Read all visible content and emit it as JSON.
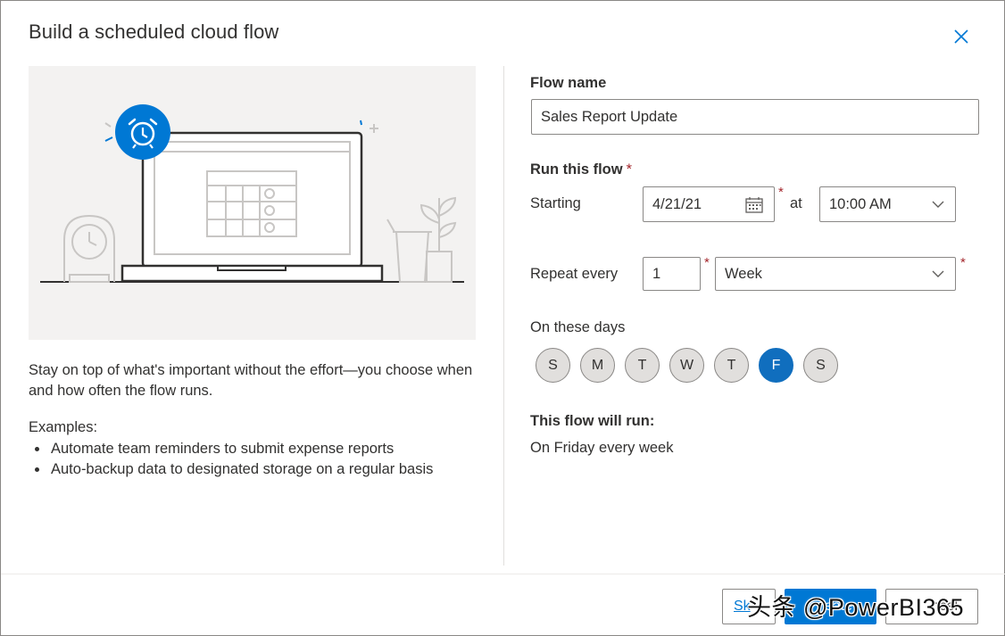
{
  "dialog": {
    "title": "Build a scheduled cloud flow",
    "close_icon": "close-icon"
  },
  "left": {
    "illustration_icon": "alarm-clock-icon",
    "description": "Stay on top of what's important without the effort—you choose when and how often the flow runs.",
    "examples_label": "Examples:",
    "examples": [
      "Automate team reminders to submit expense reports",
      "Auto-backup data to designated storage on a regular basis"
    ]
  },
  "form": {
    "flow_name_label": "Flow name",
    "flow_name_value": "Sales Report Update",
    "run_label": "Run this flow",
    "required_mark": "*",
    "starting_label": "Starting",
    "start_date": "4/21/21",
    "date_icon": "calendar-icon",
    "at_label": "at",
    "start_time": "10:00 AM",
    "repeat_label": "Repeat every",
    "repeat_value": "1",
    "repeat_unit": "Week",
    "days_label": "On these days",
    "days": [
      {
        "label": "S",
        "selected": false
      },
      {
        "label": "M",
        "selected": false
      },
      {
        "label": "T",
        "selected": false
      },
      {
        "label": "W",
        "selected": false
      },
      {
        "label": "T",
        "selected": false
      },
      {
        "label": "F",
        "selected": true
      },
      {
        "label": "S",
        "selected": false
      }
    ],
    "summary_label": "This flow will run:",
    "summary_value": "On Friday every week"
  },
  "footer": {
    "skip_label": "Sk",
    "create_label": "eate",
    "cancel_label": "ncel"
  },
  "watermark": "头条 @PowerBI365",
  "colors": {
    "accent": "#0078d4",
    "selected_day": "#106ebe",
    "required": "#a4262c",
    "illustration_bg": "#f3f2f1"
  }
}
